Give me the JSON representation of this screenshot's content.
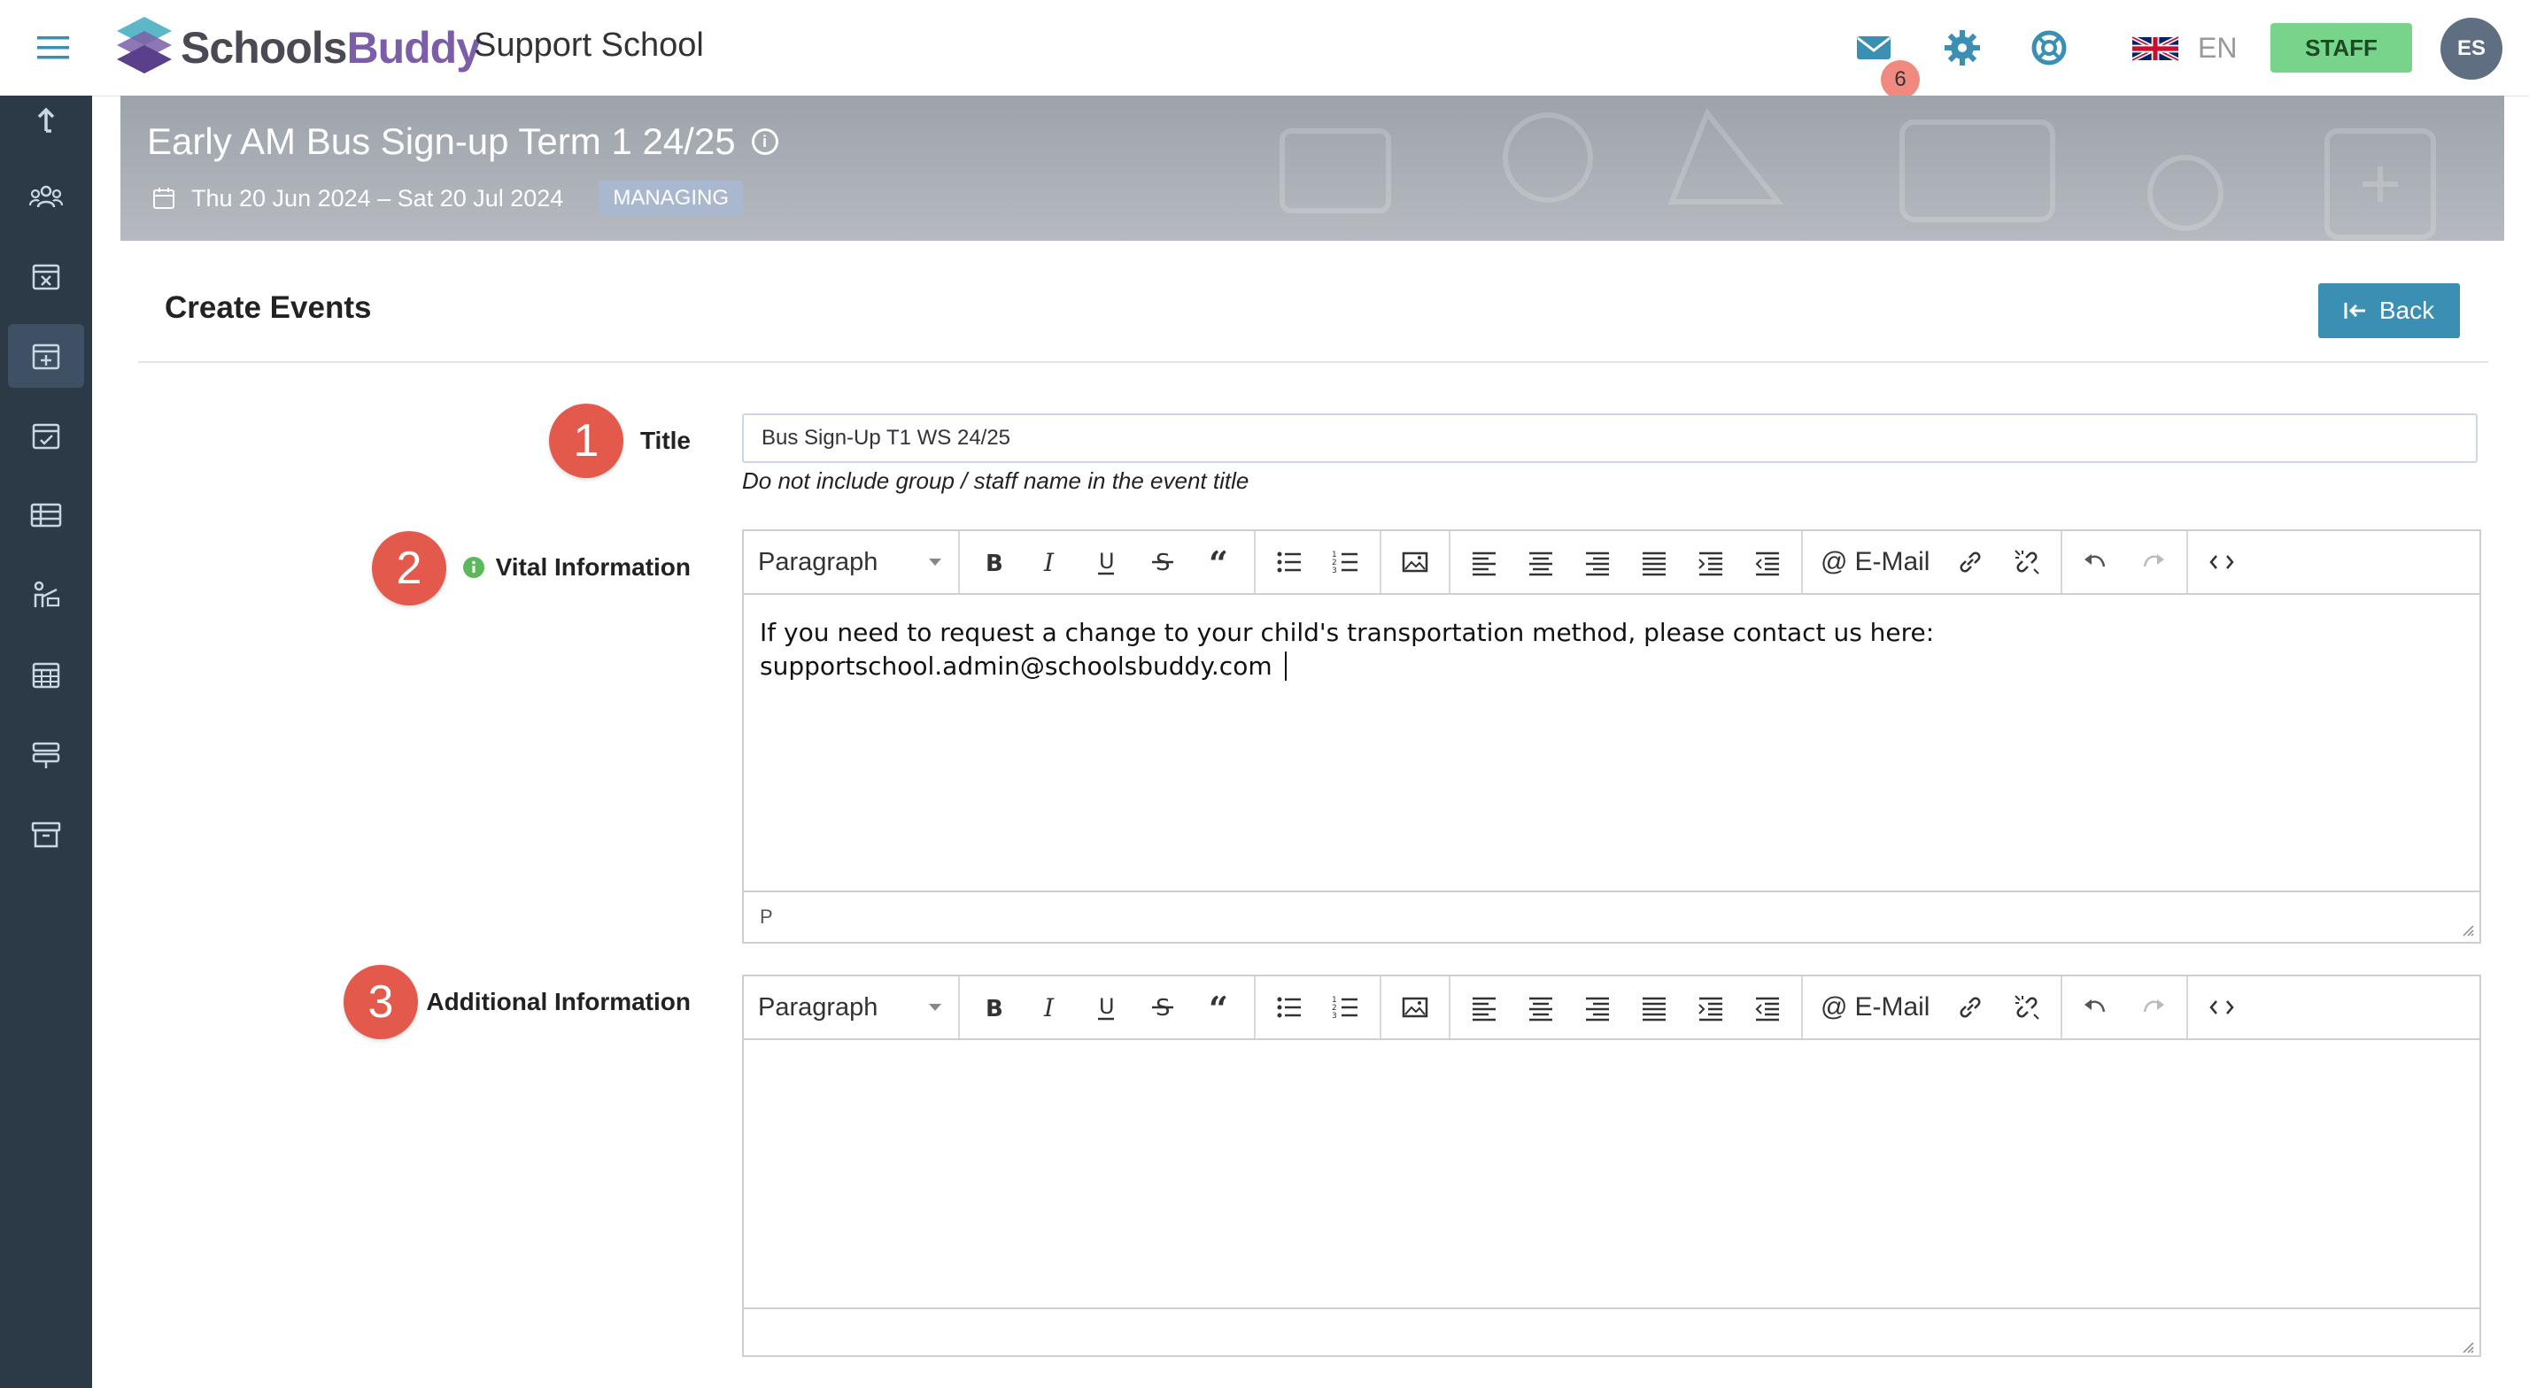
{
  "app": {
    "brand_part1": "Schools",
    "brand_part2": "Buddy",
    "school_name": "Support School",
    "message_count": "6",
    "language": "EN",
    "staff_label": "STAFF",
    "avatar_initials": "ES"
  },
  "banner": {
    "event_title": "Early AM Bus Sign-up Term 1 24/25",
    "info_glyph": "i",
    "date_range": "Thu 20 Jun 2024 – Sat 20 Jul 2024",
    "status_tag": "MANAGING"
  },
  "page": {
    "section_title": "Create Events",
    "back_label": "Back"
  },
  "form": {
    "title": {
      "step": "1",
      "label": "Title",
      "value": "Bus Sign-Up T1 WS 24/25",
      "hint": "Do not include group / staff name in the event title"
    },
    "vital": {
      "step": "2",
      "label": "Vital Information",
      "line1": "If you need to request a change to your child's transportation method, please contact us here:",
      "line2": "supportschool.admin@schoolsbuddy.com",
      "status": "P"
    },
    "additional": {
      "step": "3",
      "label": "Additional Information",
      "status": ""
    }
  },
  "editor_toolbar": {
    "paragraph_label": "Paragraph",
    "email_label": "E-Mail"
  },
  "colors": {
    "sidebar": "#2c3a47",
    "accent": "#3a8fb2",
    "step": "#e35a4c",
    "staff": "#79d48b"
  }
}
